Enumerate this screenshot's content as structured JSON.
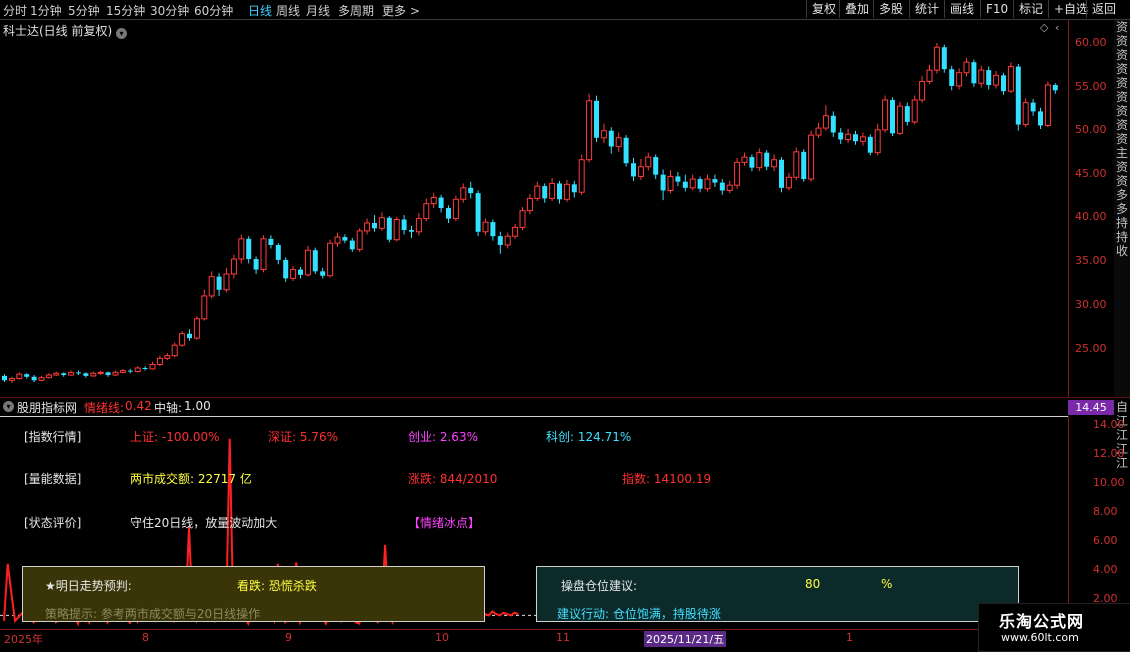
{
  "toolbar": {
    "periods": [
      "分时",
      "1分钟",
      "5分钟",
      "15分钟",
      "30分钟",
      "60分钟",
      "日线",
      "周线",
      "月线",
      "多周期",
      "更多 >"
    ],
    "active_period": "日线",
    "right_buttons": [
      "复权",
      "叠加",
      "多股",
      "统计",
      "画线",
      "F10",
      "标记",
      "+自选",
      "返回"
    ]
  },
  "stock": {
    "title": "科士达(日线 前复权)",
    "title_icon": "chevron-down-icon"
  },
  "price_axis": [
    "60.00",
    "55.00",
    "50.00",
    "45.00",
    "40.00",
    "35.00",
    "30.00",
    "25.00"
  ],
  "side_strip_text": "资资资资资资资资资主资资多多持持收",
  "indicator": {
    "name": "股朋指标网",
    "line_label": "情绪线:",
    "line_value": "0.42",
    "axis_label": "中轴:",
    "axis_value": "1.00",
    "current_value": "14.45",
    "axis_ticks": [
      "14.00",
      "12.00",
      "10.00",
      "8.00",
      "6.00",
      "4.00",
      "2.00"
    ],
    "side_text": "自江江江江"
  },
  "info_panel": {
    "row1": {
      "label": "[指数行情]",
      "sh": "上证: -100.00%",
      "sz": "深证: 5.76%",
      "cy": "创业: 2.63%",
      "kc": "科创: 124.71%"
    },
    "row2": {
      "label": "[量能数据]",
      "volume": "两市成交额: 22717 亿",
      "updown": "涨跌: 844/2010",
      "index": "指数: 14100.19"
    },
    "row3": {
      "label": "[状态评价]",
      "status": "守住20日线，放量波动加大",
      "mood": "【情绪冰点】"
    },
    "forecast": {
      "label": "★明日走势预判:",
      "value": "看跌: 恐慌杀跌",
      "hint": "策略提示: 参考两市成交额与20日线操作"
    },
    "position": {
      "label": "操盘仓位建议:",
      "value": "80",
      "unit": "%",
      "action": "建议行动: 仓位饱满，持股待涨"
    }
  },
  "date_axis": {
    "ticks": [
      "2025年",
      "8",
      "9",
      "10",
      "11",
      "1"
    ],
    "selected": "2025/11/21/五"
  },
  "watermark": {
    "name": "乐淘公式网",
    "url": "www.60lt.com"
  },
  "colors": {
    "up": "#ff3b3b",
    "down": "#33e0ff",
    "indicator": "#ff2020",
    "background": "#000000"
  },
  "chart_data": {
    "type": "candlestick",
    "price_range": [
      20.3,
      63.2
    ],
    "candles": [
      [
        22.7,
        22.2,
        22.9,
        22.0
      ],
      [
        22.2,
        22.4,
        22.6,
        21.9
      ],
      [
        22.4,
        22.9,
        23.1,
        22.3
      ],
      [
        22.9,
        22.6,
        23.0,
        22.4
      ],
      [
        22.6,
        22.2,
        22.8,
        22.0
      ],
      [
        22.2,
        22.5,
        22.7,
        22.1
      ],
      [
        22.5,
        22.8,
        23.0,
        22.4
      ],
      [
        22.8,
        23.0,
        23.2,
        22.7
      ],
      [
        23.0,
        22.8,
        23.1,
        22.6
      ],
      [
        22.8,
        23.1,
        23.3,
        22.7
      ],
      [
        23.1,
        23.0,
        23.3,
        22.8
      ],
      [
        23.0,
        22.7,
        23.1,
        22.5
      ],
      [
        22.7,
        23.0,
        23.2,
        22.6
      ],
      [
        23.0,
        23.1,
        23.3,
        22.8
      ],
      [
        23.1,
        22.8,
        23.2,
        22.6
      ],
      [
        22.8,
        23.1,
        23.3,
        22.7
      ],
      [
        23.1,
        23.3,
        23.5,
        23.0
      ],
      [
        23.3,
        23.2,
        23.5,
        23.0
      ],
      [
        23.2,
        23.6,
        23.8,
        23.1
      ],
      [
        23.6,
        23.5,
        23.8,
        23.3
      ],
      [
        23.5,
        24.0,
        24.3,
        23.4
      ],
      [
        24.0,
        24.7,
        25.0,
        23.8
      ],
      [
        24.7,
        25.0,
        25.3,
        24.5
      ],
      [
        25.0,
        26.2,
        26.5,
        24.8
      ],
      [
        26.2,
        27.5,
        27.8,
        26.0
      ],
      [
        27.5,
        27.0,
        28.0,
        26.7
      ],
      [
        27.0,
        29.2,
        29.5,
        26.8
      ],
      [
        29.2,
        31.8,
        32.5,
        29.0
      ],
      [
        31.8,
        34.0,
        34.6,
        31.5
      ],
      [
        34.0,
        32.5,
        34.4,
        31.8
      ],
      [
        32.5,
        34.3,
        35.0,
        32.2
      ],
      [
        34.3,
        36.0,
        36.5,
        33.8
      ],
      [
        36.0,
        38.3,
        38.8,
        35.5
      ],
      [
        38.3,
        36.0,
        38.6,
        35.5
      ],
      [
        36.0,
        34.8,
        36.3,
        34.3
      ],
      [
        34.8,
        38.3,
        38.7,
        34.5
      ],
      [
        38.3,
        37.6,
        38.7,
        37.2
      ],
      [
        37.6,
        35.9,
        37.8,
        35.4
      ],
      [
        35.9,
        33.8,
        36.2,
        33.4
      ],
      [
        33.8,
        34.8,
        35.2,
        33.5
      ],
      [
        34.8,
        34.2,
        35.1,
        33.8
      ],
      [
        34.2,
        37.0,
        37.5,
        34.0
      ],
      [
        37.0,
        34.6,
        37.3,
        34.3
      ],
      [
        34.6,
        34.1,
        35.0,
        33.8
      ],
      [
        34.1,
        37.8,
        38.2,
        33.9
      ],
      [
        37.8,
        38.5,
        39.0,
        37.4
      ],
      [
        38.5,
        38.1,
        38.8,
        37.8
      ],
      [
        38.1,
        37.1,
        38.4,
        36.8
      ],
      [
        37.1,
        39.2,
        39.5,
        36.8
      ],
      [
        39.2,
        40.1,
        40.6,
        38.8
      ],
      [
        40.1,
        39.5,
        41.0,
        39.1
      ],
      [
        39.5,
        40.7,
        41.3,
        39.2
      ],
      [
        40.7,
        38.2,
        40.9,
        37.9
      ],
      [
        38.2,
        40.5,
        40.8,
        38.0
      ],
      [
        40.5,
        39.3,
        41.0,
        38.8
      ],
      [
        39.3,
        39.1,
        39.8,
        38.4
      ],
      [
        39.1,
        40.6,
        41.2,
        38.7
      ],
      [
        40.6,
        42.3,
        42.9,
        40.3
      ],
      [
        42.3,
        43.0,
        43.5,
        41.8
      ],
      [
        43.0,
        41.8,
        43.3,
        41.3
      ],
      [
        41.8,
        40.6,
        42.1,
        40.1
      ],
      [
        40.6,
        42.8,
        43.2,
        40.3
      ],
      [
        42.8,
        44.1,
        44.6,
        42.4
      ],
      [
        44.1,
        43.5,
        44.8,
        42.9
      ],
      [
        43.5,
        39.1,
        43.8,
        38.6
      ],
      [
        39.1,
        40.2,
        40.6,
        38.7
      ],
      [
        40.2,
        38.6,
        40.5,
        38.1
      ],
      [
        38.6,
        37.6,
        39.1,
        36.6
      ],
      [
        37.6,
        38.6,
        39.0,
        37.2
      ],
      [
        38.6,
        39.6,
        40.0,
        38.3
      ],
      [
        39.6,
        41.5,
        41.9,
        39.3
      ],
      [
        41.5,
        42.9,
        43.4,
        41.1
      ],
      [
        42.9,
        44.3,
        44.8,
        42.6
      ],
      [
        44.3,
        42.9,
        44.6,
        42.4
      ],
      [
        42.9,
        44.6,
        45.2,
        42.6
      ],
      [
        44.6,
        42.8,
        44.9,
        42.3
      ],
      [
        42.8,
        44.5,
        45.0,
        42.5
      ],
      [
        44.5,
        43.6,
        44.9,
        43.0
      ],
      [
        43.6,
        47.3,
        47.9,
        43.3
      ],
      [
        47.3,
        54.0,
        54.8,
        47.0
      ],
      [
        54.0,
        49.8,
        54.6,
        49.3
      ],
      [
        49.8,
        50.6,
        51.4,
        49.2
      ],
      [
        50.6,
        48.8,
        51.0,
        48.0
      ],
      [
        48.8,
        49.8,
        50.4,
        48.2
      ],
      [
        49.8,
        46.9,
        50.1,
        46.5
      ],
      [
        46.9,
        45.4,
        47.5,
        44.9
      ],
      [
        45.4,
        46.5,
        47.4,
        45.0
      ],
      [
        46.5,
        47.6,
        48.1,
        46.1
      ],
      [
        47.6,
        45.6,
        47.9,
        45.1
      ],
      [
        45.6,
        43.8,
        46.2,
        42.7
      ],
      [
        43.8,
        45.4,
        46.1,
        43.5
      ],
      [
        45.4,
        44.8,
        45.9,
        44.3
      ],
      [
        44.8,
        44.1,
        45.6,
        43.7
      ],
      [
        44.1,
        45.1,
        45.6,
        43.8
      ],
      [
        45.1,
        44.0,
        45.4,
        43.6
      ],
      [
        44.0,
        45.1,
        45.6,
        43.7
      ],
      [
        45.1,
        44.7,
        45.6,
        44.2
      ],
      [
        44.7,
        43.8,
        45.1,
        43.3
      ],
      [
        43.8,
        44.4,
        44.9,
        43.5
      ],
      [
        44.4,
        47.0,
        47.5,
        44.0
      ],
      [
        47.0,
        47.6,
        48.1,
        46.6
      ],
      [
        47.6,
        46.4,
        47.9,
        46.0
      ],
      [
        46.4,
        48.1,
        48.6,
        46.0
      ],
      [
        48.1,
        46.5,
        48.4,
        46.1
      ],
      [
        46.5,
        47.3,
        47.9,
        46.0
      ],
      [
        47.3,
        44.1,
        47.6,
        43.6
      ],
      [
        44.1,
        45.3,
        45.8,
        43.8
      ],
      [
        45.3,
        48.2,
        48.7,
        45.0
      ],
      [
        48.2,
        45.1,
        48.5,
        44.8
      ],
      [
        45.1,
        50.1,
        50.6,
        44.8
      ],
      [
        50.1,
        50.9,
        51.5,
        49.8
      ],
      [
        50.9,
        52.3,
        53.5,
        50.6
      ],
      [
        52.3,
        50.4,
        52.8,
        49.9
      ],
      [
        50.4,
        49.6,
        50.9,
        49.1
      ],
      [
        49.6,
        50.2,
        50.8,
        49.2
      ],
      [
        50.2,
        49.4,
        50.6,
        49.0
      ],
      [
        49.4,
        49.9,
        50.4,
        48.9
      ],
      [
        49.9,
        48.1,
        50.2,
        47.8
      ],
      [
        48.1,
        50.7,
        51.4,
        47.8
      ],
      [
        50.7,
        54.1,
        54.6,
        50.4
      ],
      [
        54.1,
        50.3,
        54.4,
        50.0
      ],
      [
        50.3,
        53.4,
        53.9,
        50.1
      ],
      [
        53.4,
        51.6,
        53.8,
        51.2
      ],
      [
        51.6,
        54.1,
        54.6,
        51.3
      ],
      [
        54.1,
        56.2,
        56.8,
        53.8
      ],
      [
        56.2,
        57.5,
        58.1,
        55.9
      ],
      [
        57.5,
        60.1,
        60.6,
        57.1
      ],
      [
        60.1,
        57.6,
        60.4,
        57.2
      ],
      [
        57.6,
        55.7,
        58.0,
        55.2
      ],
      [
        55.7,
        57.2,
        57.7,
        55.3
      ],
      [
        57.2,
        58.4,
        58.9,
        56.8
      ],
      [
        58.4,
        56.0,
        58.7,
        55.6
      ],
      [
        56.0,
        57.5,
        58.0,
        55.5
      ],
      [
        57.5,
        55.8,
        57.9,
        55.3
      ],
      [
        55.8,
        56.9,
        57.4,
        55.4
      ],
      [
        56.9,
        55.1,
        57.2,
        54.7
      ],
      [
        55.1,
        57.9,
        58.4,
        54.9
      ],
      [
        57.9,
        51.3,
        58.2,
        50.6
      ],
      [
        51.3,
        53.8,
        54.3,
        51.0
      ],
      [
        53.8,
        52.8,
        54.2,
        52.3
      ],
      [
        52.8,
        51.2,
        53.2,
        50.8
      ],
      [
        51.2,
        55.8,
        56.2,
        51.0
      ],
      [
        55.8,
        55.2,
        56.0,
        54.8
      ]
    ],
    "indicator_line": [
      0.6,
      4.8,
      2.6,
      0.6,
      0.9,
      1.2,
      1.5,
      0.9,
      0.5,
      1.0,
      1.3,
      0.6,
      0.8,
      1.1,
      0.5,
      0.7,
      1.0,
      1.5,
      2.9,
      0.9,
      0.4,
      1.8,
      0.9,
      0.5,
      3.8,
      0.8,
      1.4,
      2.7,
      0.5,
      0.9,
      1.1,
      0.7,
      4.2,
      2.1,
      0.4,
      1.2,
      0.6,
      2.4,
      0.8,
      1.5,
      1.0,
      0.6,
      1.3,
      0.8,
      3.6,
      1.2,
      0.5,
      4.0,
      1.5,
      0.8,
      7.5,
      1.1,
      0.6,
      1.8,
      0.7,
      3.9,
      2.0,
      0.5,
      1.5,
      1.2,
      0.6,
      14.0,
      0.8,
      1.2,
      2.4,
      0.9,
      0.4,
      1.4,
      0.6,
      3.5,
      0.8,
      1.6,
      1.1,
      0.6,
      4.8,
      1.3,
      0.5,
      0.9,
      1.8,
      4.9,
      0.5,
      1.0,
      0.8,
      1.5,
      0.6,
      3.5,
      0.9,
      0.4,
      1.2,
      1.7,
      1.0,
      0.6,
      2.6,
      1.1,
      1.3,
      0.5,
      0.4,
      1.5,
      1.0,
      1.6,
      0.8,
      0.5,
      1.1,
      6.2,
      1.0,
      0.5,
      2.0,
      1.3,
      1.2,
      1.3,
      1.4,
      1.1,
      1.0,
      1.3,
      1.2,
      1.0,
      0.9,
      1.3,
      1.5,
      1.1,
      1.3,
      1.0,
      1.1,
      1.2,
      1.4,
      1.0,
      1.1,
      1.2,
      1.3,
      1.0,
      1.1,
      1.0,
      1.3,
      1.1,
      1.0,
      1.2,
      1.1,
      1.0,
      1.2,
      1.1
    ],
    "indicator_range": [
      0,
      15.6
    ],
    "indicator_axis": 1.0,
    "indicator_visible_until": 75
  }
}
